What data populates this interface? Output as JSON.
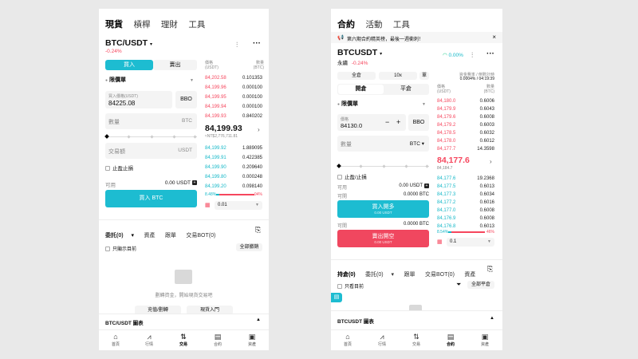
{
  "spot": {
    "tabs": [
      "現貨",
      "槓桿",
      "理財",
      "工具"
    ],
    "pair": "BTC/USDT",
    "change": "-0.24%",
    "buy_label": "買入",
    "sell_label": "賣出",
    "order_type": "限價單",
    "price_label": "買入價格(USDT)",
    "price_value": "84225.08",
    "bbo": "BBO",
    "qty_label": "數量",
    "qty_unit": "BTC",
    "amount_label": "交易額",
    "amount_unit": "USDT",
    "tpsl": "止盈止損",
    "avail_label": "可用",
    "avail_value": "0.00 USDT",
    "submit": "買入 BTC",
    "ob_price_head": "價格\n(USDT)",
    "ob_qty_head": "數量\n(BTC)",
    "asks": [
      {
        "p": "84,202.58",
        "q": "0.101353"
      },
      {
        "p": "84,199.96",
        "q": "0.000100"
      },
      {
        "p": "84,199.95",
        "q": "0.000100"
      },
      {
        "p": "84,199.94",
        "q": "0.000100"
      },
      {
        "p": "84,199.93",
        "q": "0.840202"
      }
    ],
    "last_price": "84,199.93",
    "last_sub": "≈NT$2,776,711.81",
    "bids": [
      {
        "p": "84,199.92",
        "q": "1.889095"
      },
      {
        "p": "84,199.91",
        "q": "0.422385"
      },
      {
        "p": "84,199.90",
        "q": "0.209640"
      },
      {
        "p": "84,199.80",
        "q": "0.000248"
      },
      {
        "p": "84,199.20",
        "q": "0.098140"
      }
    ],
    "ratio_buy": "8.48%",
    "ratio_sell": "94%",
    "buy_ratio_value": 0.0848,
    "depth": "0.01",
    "orders_tabs": [
      "委託(0)",
      "資產",
      "跟單",
      "交易BOT(0)"
    ],
    "only_current": "只顯示目前",
    "cancel_all": "全部撤銷",
    "empty_text": "劃轉資金，開始現貨交易吧",
    "btn_deposit": "充值/劃轉",
    "btn_earn": "現貨入門",
    "chart_label": "BTC/USDT  圖表",
    "nav": [
      "首頁",
      "行情",
      "交易",
      "合約",
      "資產"
    ]
  },
  "futures": {
    "tabs": [
      "合約",
      "活動",
      "工具"
    ],
    "banner": "第六期合約精英榜，最後一週衝刺！",
    "pair": "BTCUSDT",
    "type": "永續",
    "change": "-0.24%",
    "gauge": "0.00%",
    "margin_mode": "全倉",
    "leverage": "10x",
    "mode": "單",
    "open_label": "開倉",
    "close_label": "平倉",
    "funding_label": "資金費率 / 倒數計時",
    "funding_value": "0.0004% / 04:19:39",
    "order_type": "限價單",
    "price_label": "價格",
    "price_value": "84130.0",
    "bbo": "BBO",
    "qty_label": "數量",
    "qty_unit": "BTC",
    "tpsl": "止盈/止損",
    "avail_label": "可用",
    "avail_value": "0.00 USDT",
    "openable_label": "可開",
    "openable_value": "0.0000 BTC",
    "btn_long": "買入開多",
    "btn_long_sub": "0.00 USDT",
    "btn_short": "賣出開空",
    "btn_short_sub": "0.00 USDT",
    "openable2_value": "0.0000 BTC",
    "ob_price_head": "價格\n(USDT)",
    "ob_qty_head": "數量\n(BTC)",
    "asks": [
      {
        "p": "84,180.0",
        "q": "0.6006"
      },
      {
        "p": "84,179.9",
        "q": "0.6043"
      },
      {
        "p": "84,179.6",
        "q": "0.6008"
      },
      {
        "p": "84,179.2",
        "q": "0.6003"
      },
      {
        "p": "84,178.5",
        "q": "0.6032"
      },
      {
        "p": "84,178.0",
        "q": "0.6012"
      },
      {
        "p": "84,177.7",
        "q": "14.3598"
      }
    ],
    "last_price": "84,177.6",
    "last_sub": "84,184.7",
    "bids": [
      {
        "p": "84,177.6",
        "q": "19.2368"
      },
      {
        "p": "84,177.5",
        "q": "0.6013"
      },
      {
        "p": "84,177.3",
        "q": "0.6034"
      },
      {
        "p": "84,177.2",
        "q": "0.6016"
      },
      {
        "p": "84,177.0",
        "q": "0.6008"
      },
      {
        "p": "84,176.9",
        "q": "0.6008"
      },
      {
        "p": "84,176.8",
        "q": "0.6013"
      }
    ],
    "ratio_buy": "8.54%",
    "ratio_sell": "46%",
    "buy_ratio_value": 0.0854,
    "depth": "0.1",
    "orders_tabs": [
      "持倉(0)",
      "委託(0)",
      "跟單",
      "交易BOT(0)",
      "資產"
    ],
    "only_current": "只看目前",
    "close_all": "全部平倉",
    "chart_label": "BTCUSDT  圖表",
    "nav": [
      "首頁",
      "行情",
      "交易",
      "合約",
      "資產"
    ]
  }
}
